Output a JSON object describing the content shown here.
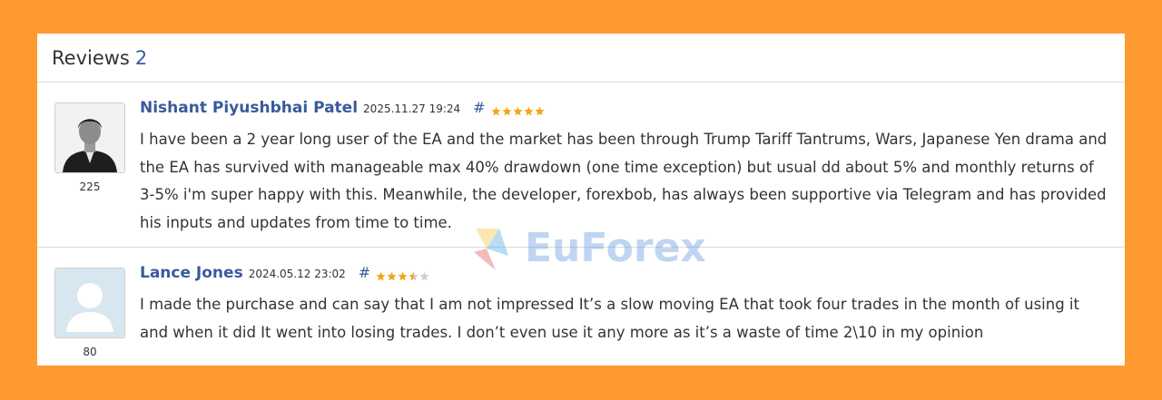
{
  "header": {
    "title": "Reviews",
    "count": "2"
  },
  "watermark": {
    "text": "EuForex"
  },
  "reviews": [
    {
      "author": "Nishant Piyushbhai Patel",
      "date": "2025.11.27 19:24",
      "hash": "#",
      "rating": 5,
      "avatar_count": "225",
      "text": "I have been a 2 year long user of the EA and the market has been through Trump Tariff Tantrums, Wars, Japanese Yen drama and the EA has survived with manageable max 40% drawdown (one time exception) but usual dd about 5% and monthly returns of 3-5% i'm super happy with this. Meanwhile, the developer, forexbob, has always been supportive via Telegram and has provided his inputs and updates from time to time."
    },
    {
      "author": "Lance Jones",
      "date": "2024.05.12 23:02",
      "hash": "#",
      "rating": 3.5,
      "avatar_count": "80",
      "text": "I made the purchase and can say that I am not impressed It’s a slow moving EA that took four trades in the month of using it and when it did It went into losing trades. I don’t even use it any more as it’s a waste of time 2\\10 in my opinion"
    }
  ],
  "colors": {
    "accent": "#3a5a9c",
    "star": "#f0a818",
    "background": "#ff9a30"
  }
}
